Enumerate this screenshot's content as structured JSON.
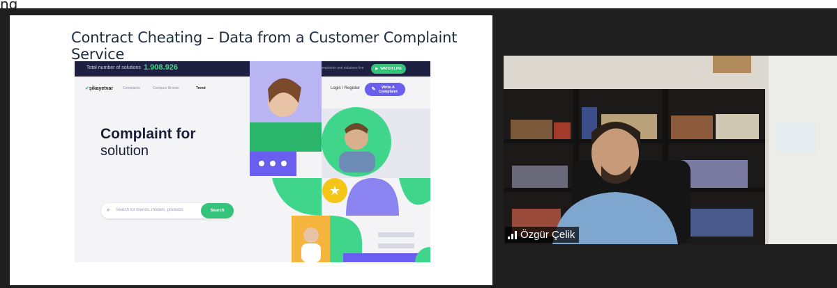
{
  "header": {
    "partial_text": "ng"
  },
  "slide": {
    "title": "Contract Cheating – Data from a Customer Complaint Service",
    "site": {
      "topbar": {
        "label": "Total number of solutions",
        "count": "1.908.926",
        "follow_text": "Follow complaints and solutions live",
        "watch_label": "WATCH LIVE"
      },
      "nav": {
        "logo": "şikayetvar",
        "links": [
          "Complaints",
          "Compare Brands"
        ],
        "trend": "Trend",
        "login": "Login / Register",
        "write_button": "Write A Complaint"
      },
      "hero": {
        "title": "Complaint for",
        "subtitle": "solution"
      },
      "search": {
        "placeholder": "Search for brands, models, products",
        "button": "Search"
      }
    }
  },
  "participant": {
    "name": "Özgür Çelik"
  },
  "colors": {
    "accent_green": "#35c27a",
    "accent_purple": "#6a5ef0",
    "topbar_navy": "#1d2040",
    "meeting_bg": "#1f1f1f"
  }
}
